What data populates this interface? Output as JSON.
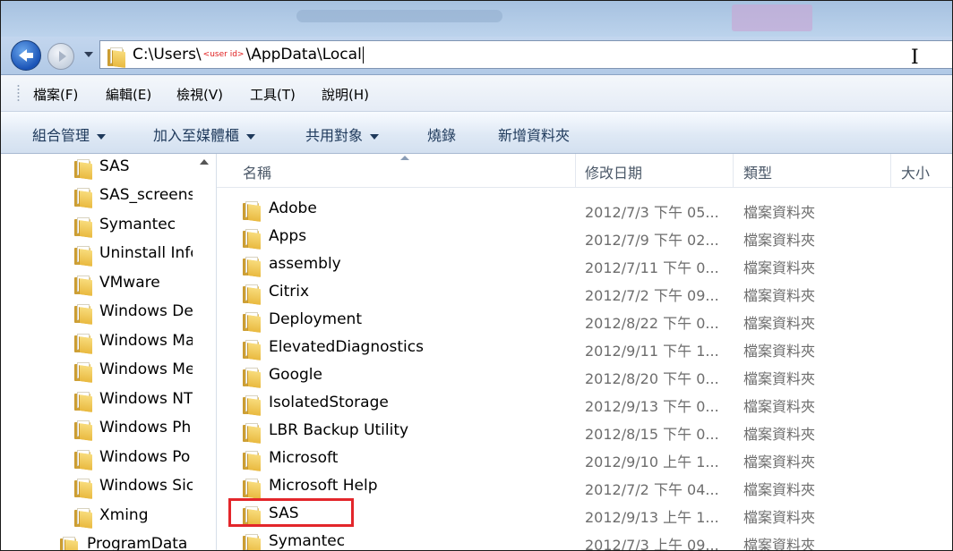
{
  "window": {
    "address_path_prefix": "C:\\Users\\",
    "address_user_token": "<user id>",
    "address_path_suffix": "\\AppData\\Local"
  },
  "menu": [
    {
      "label": "檔案(F)"
    },
    {
      "label": "編輯(E)"
    },
    {
      "label": "檢視(V)"
    },
    {
      "label": "工具(T)"
    },
    {
      "label": "說明(H)"
    }
  ],
  "commands": [
    {
      "label": "組合管理",
      "has_dropdown": true
    },
    {
      "label": "加入至媒體櫃",
      "has_dropdown": true
    },
    {
      "label": "共用對象",
      "has_dropdown": true
    },
    {
      "label": "燒錄",
      "has_dropdown": false
    },
    {
      "label": "新增資料夾",
      "has_dropdown": false
    }
  ],
  "nav_tree": [
    {
      "label": "SAS"
    },
    {
      "label": "SAS_screens"
    },
    {
      "label": "Symantec"
    },
    {
      "label": "Uninstall Info"
    },
    {
      "label": "VMware"
    },
    {
      "label": "Windows De"
    },
    {
      "label": "Windows Ma"
    },
    {
      "label": "Windows Me"
    },
    {
      "label": "Windows NT"
    },
    {
      "label": "Windows Ph"
    },
    {
      "label": "Windows Po"
    },
    {
      "label": "Windows Sic"
    },
    {
      "label": "Xming"
    },
    {
      "label": "ProgramData"
    }
  ],
  "columns": {
    "name": "名稱",
    "modified": "修改日期",
    "type": "類型",
    "size": "大小"
  },
  "files": [
    {
      "name": "Adobe",
      "modified": "2012/7/3 下午 05...",
      "type": "檔案資料夾"
    },
    {
      "name": "Apps",
      "modified": "2012/7/9 下午 02...",
      "type": "檔案資料夾"
    },
    {
      "name": "assembly",
      "modified": "2012/7/11 下午 0...",
      "type": "檔案資料夾"
    },
    {
      "name": "Citrix",
      "modified": "2012/7/2 下午 09...",
      "type": "檔案資料夾"
    },
    {
      "name": "Deployment",
      "modified": "2012/8/22 下午 0...",
      "type": "檔案資料夾"
    },
    {
      "name": "ElevatedDiagnostics",
      "modified": "2012/9/11 下午 1...",
      "type": "檔案資料夾"
    },
    {
      "name": "Google",
      "modified": "2012/8/20 下午 0...",
      "type": "檔案資料夾"
    },
    {
      "name": "IsolatedStorage",
      "modified": "2012/9/13 下午 0...",
      "type": "檔案資料夾"
    },
    {
      "name": "LBR Backup Utility",
      "modified": "2012/8/15 下午 0...",
      "type": "檔案資料夾"
    },
    {
      "name": "Microsoft",
      "modified": "2012/9/10 上午 1...",
      "type": "檔案資料夾"
    },
    {
      "name": "Microsoft Help",
      "modified": "2012/7/2 下午 04...",
      "type": "檔案資料夾"
    },
    {
      "name": "SAS",
      "modified": "2012/9/13 上午 1...",
      "type": "檔案資料夾",
      "highlighted": true
    },
    {
      "name": "Symantec",
      "modified": "2012/7/3 上午 09...",
      "type": "檔案資料夾"
    }
  ],
  "colors": {
    "highlight_border": "#e3262b",
    "user_token": "#e02020"
  }
}
